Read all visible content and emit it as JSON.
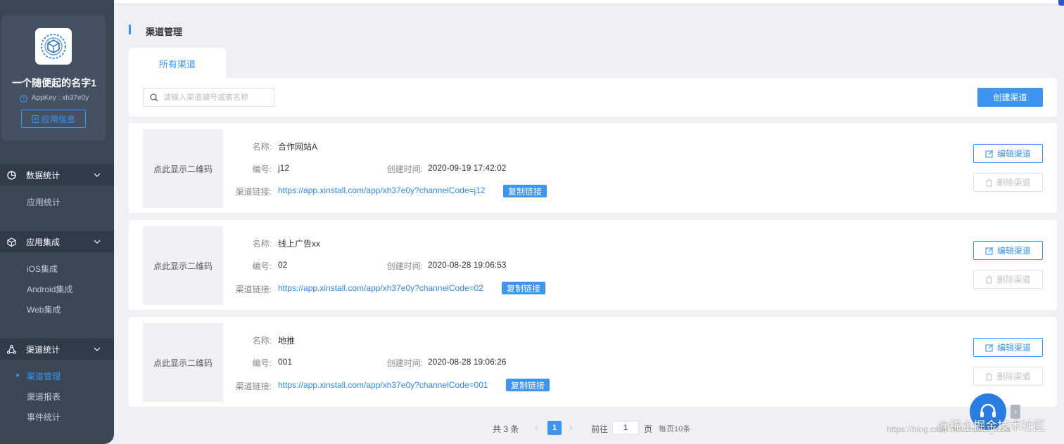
{
  "sidebar": {
    "app_name": "一个随便起的名字1",
    "app_key": "AppKey : xh37e0y",
    "app_info_button": "应用信息",
    "groups": [
      {
        "label": "数据统计",
        "items": [
          "应用统计"
        ]
      },
      {
        "label": "应用集成",
        "items": [
          "iOS集成",
          "Android集成",
          "Web集成"
        ]
      },
      {
        "label": "渠道统计",
        "items": [
          "渠道管理",
          "渠道报表",
          "事件统计"
        ]
      }
    ],
    "active_item": "渠道管理"
  },
  "page": {
    "title": "渠道管理",
    "tab": "所有渠道",
    "search_placeholder": "请输入渠道编号或者名称",
    "create_button": "创建渠道"
  },
  "labels": {
    "name": "名称:",
    "code": "编号:",
    "created": "创建时间:",
    "link": "渠道链接:",
    "qr": "点此显示二维码",
    "copy": "复制链接",
    "edit": "编辑渠道",
    "delete": "删除渠道"
  },
  "channels": [
    {
      "name": "合作网站A",
      "code": "j12",
      "created": "2020-09-19 17:42:02",
      "link": "https://app.xinstall.com/app/xh37e0y?channelCode=j12"
    },
    {
      "name": "线上广告xx",
      "code": "02",
      "created": "2020-08-28 19:06:53",
      "link": "https://app.xinstall.com/app/xh37e0y?channelCode=02"
    },
    {
      "name": "地推",
      "code": "001",
      "created": "2020-08-28 19:06:26",
      "link": "https://app.xinstall.com/app/xh37e0y?channelCode=001"
    }
  ],
  "pagination": {
    "total": "共 3 条",
    "current": "1",
    "goto_label": "前往",
    "goto_value": "1",
    "page_suffix": "页",
    "page_size": "每页10条"
  },
  "watermark": {
    "main": "@稀土掘金技术社区",
    "sub": "https://blog.csdn.net/chaifei_mea"
  },
  "colors": {
    "accent": "#3d95f0",
    "sidebar": "#3a4556",
    "sidebar_group": "#2f3a4a"
  }
}
